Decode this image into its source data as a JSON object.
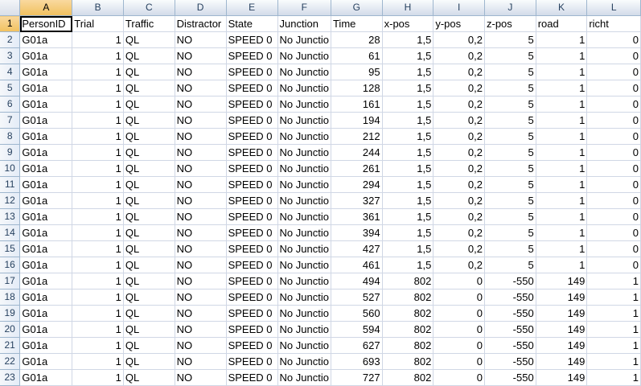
{
  "columns": [
    "A",
    "B",
    "C",
    "D",
    "E",
    "F",
    "G",
    "H",
    "I",
    "J",
    "K",
    "L"
  ],
  "active_column": "A",
  "active_row": "1",
  "rows": [
    {
      "n": "1",
      "cells": [
        "PersonID",
        "Trial",
        "Traffic",
        "Distractor",
        "State",
        "Junction",
        "Time",
        "x-pos",
        "y-pos",
        "z-pos",
        "road",
        "richt"
      ]
    },
    {
      "n": "2",
      "cells": [
        "G01a",
        "1",
        "QL",
        "NO",
        "SPEED 0",
        "No Junctio",
        "28",
        "1,5",
        "0,2",
        "5",
        "1",
        "0"
      ]
    },
    {
      "n": "3",
      "cells": [
        "G01a",
        "1",
        "QL",
        "NO",
        "SPEED 0",
        "No Junctio",
        "61",
        "1,5",
        "0,2",
        "5",
        "1",
        "0"
      ]
    },
    {
      "n": "4",
      "cells": [
        "G01a",
        "1",
        "QL",
        "NO",
        "SPEED 0",
        "No Junctio",
        "95",
        "1,5",
        "0,2",
        "5",
        "1",
        "0"
      ]
    },
    {
      "n": "5",
      "cells": [
        "G01a",
        "1",
        "QL",
        "NO",
        "SPEED 0",
        "No Junctio",
        "128",
        "1,5",
        "0,2",
        "5",
        "1",
        "0"
      ]
    },
    {
      "n": "6",
      "cells": [
        "G01a",
        "1",
        "QL",
        "NO",
        "SPEED 0",
        "No Junctio",
        "161",
        "1,5",
        "0,2",
        "5",
        "1",
        "0"
      ]
    },
    {
      "n": "7",
      "cells": [
        "G01a",
        "1",
        "QL",
        "NO",
        "SPEED 0",
        "No Junctio",
        "194",
        "1,5",
        "0,2",
        "5",
        "1",
        "0"
      ]
    },
    {
      "n": "8",
      "cells": [
        "G01a",
        "1",
        "QL",
        "NO",
        "SPEED 0",
        "No Junctio",
        "212",
        "1,5",
        "0,2",
        "5",
        "1",
        "0"
      ]
    },
    {
      "n": "9",
      "cells": [
        "G01a",
        "1",
        "QL",
        "NO",
        "SPEED 0",
        "No Junctio",
        "244",
        "1,5",
        "0,2",
        "5",
        "1",
        "0"
      ]
    },
    {
      "n": "10",
      "cells": [
        "G01a",
        "1",
        "QL",
        "NO",
        "SPEED 0",
        "No Junctio",
        "261",
        "1,5",
        "0,2",
        "5",
        "1",
        "0"
      ]
    },
    {
      "n": "11",
      "cells": [
        "G01a",
        "1",
        "QL",
        "NO",
        "SPEED 0",
        "No Junctio",
        "294",
        "1,5",
        "0,2",
        "5",
        "1",
        "0"
      ]
    },
    {
      "n": "12",
      "cells": [
        "G01a",
        "1",
        "QL",
        "NO",
        "SPEED 0",
        "No Junctio",
        "327",
        "1,5",
        "0,2",
        "5",
        "1",
        "0"
      ]
    },
    {
      "n": "13",
      "cells": [
        "G01a",
        "1",
        "QL",
        "NO",
        "SPEED 0",
        "No Junctio",
        "361",
        "1,5",
        "0,2",
        "5",
        "1",
        "0"
      ]
    },
    {
      "n": "14",
      "cells": [
        "G01a",
        "1",
        "QL",
        "NO",
        "SPEED 0",
        "No Junctio",
        "394",
        "1,5",
        "0,2",
        "5",
        "1",
        "0"
      ]
    },
    {
      "n": "15",
      "cells": [
        "G01a",
        "1",
        "QL",
        "NO",
        "SPEED 0",
        "No Junctio",
        "427",
        "1,5",
        "0,2",
        "5",
        "1",
        "0"
      ]
    },
    {
      "n": "16",
      "cells": [
        "G01a",
        "1",
        "QL",
        "NO",
        "SPEED 0",
        "No Junctio",
        "461",
        "1,5",
        "0,2",
        "5",
        "1",
        "0"
      ]
    },
    {
      "n": "17",
      "cells": [
        "G01a",
        "1",
        "QL",
        "NO",
        "SPEED 0",
        "No Junctio",
        "494",
        "802",
        "0",
        "-550",
        "149",
        "1"
      ]
    },
    {
      "n": "18",
      "cells": [
        "G01a",
        "1",
        "QL",
        "NO",
        "SPEED 0",
        "No Junctio",
        "527",
        "802",
        "0",
        "-550",
        "149",
        "1"
      ]
    },
    {
      "n": "19",
      "cells": [
        "G01a",
        "1",
        "QL",
        "NO",
        "SPEED 0",
        "No Junctio",
        "560",
        "802",
        "0",
        "-550",
        "149",
        "1"
      ]
    },
    {
      "n": "20",
      "cells": [
        "G01a",
        "1",
        "QL",
        "NO",
        "SPEED 0",
        "No Junctio",
        "594",
        "802",
        "0",
        "-550",
        "149",
        "1"
      ]
    },
    {
      "n": "21",
      "cells": [
        "G01a",
        "1",
        "QL",
        "NO",
        "SPEED 0",
        "No Junctio",
        "627",
        "802",
        "0",
        "-550",
        "149",
        "1"
      ]
    },
    {
      "n": "22",
      "cells": [
        "G01a",
        "1",
        "QL",
        "NO",
        "SPEED 0",
        "No Junctio",
        "693",
        "802",
        "0",
        "-550",
        "149",
        "1"
      ]
    },
    {
      "n": "23",
      "cells": [
        "G01a",
        "1",
        "QL",
        "NO",
        "SPEED 0",
        "No Junctio",
        "727",
        "802",
        "0",
        "-550",
        "149",
        "1"
      ]
    }
  ]
}
